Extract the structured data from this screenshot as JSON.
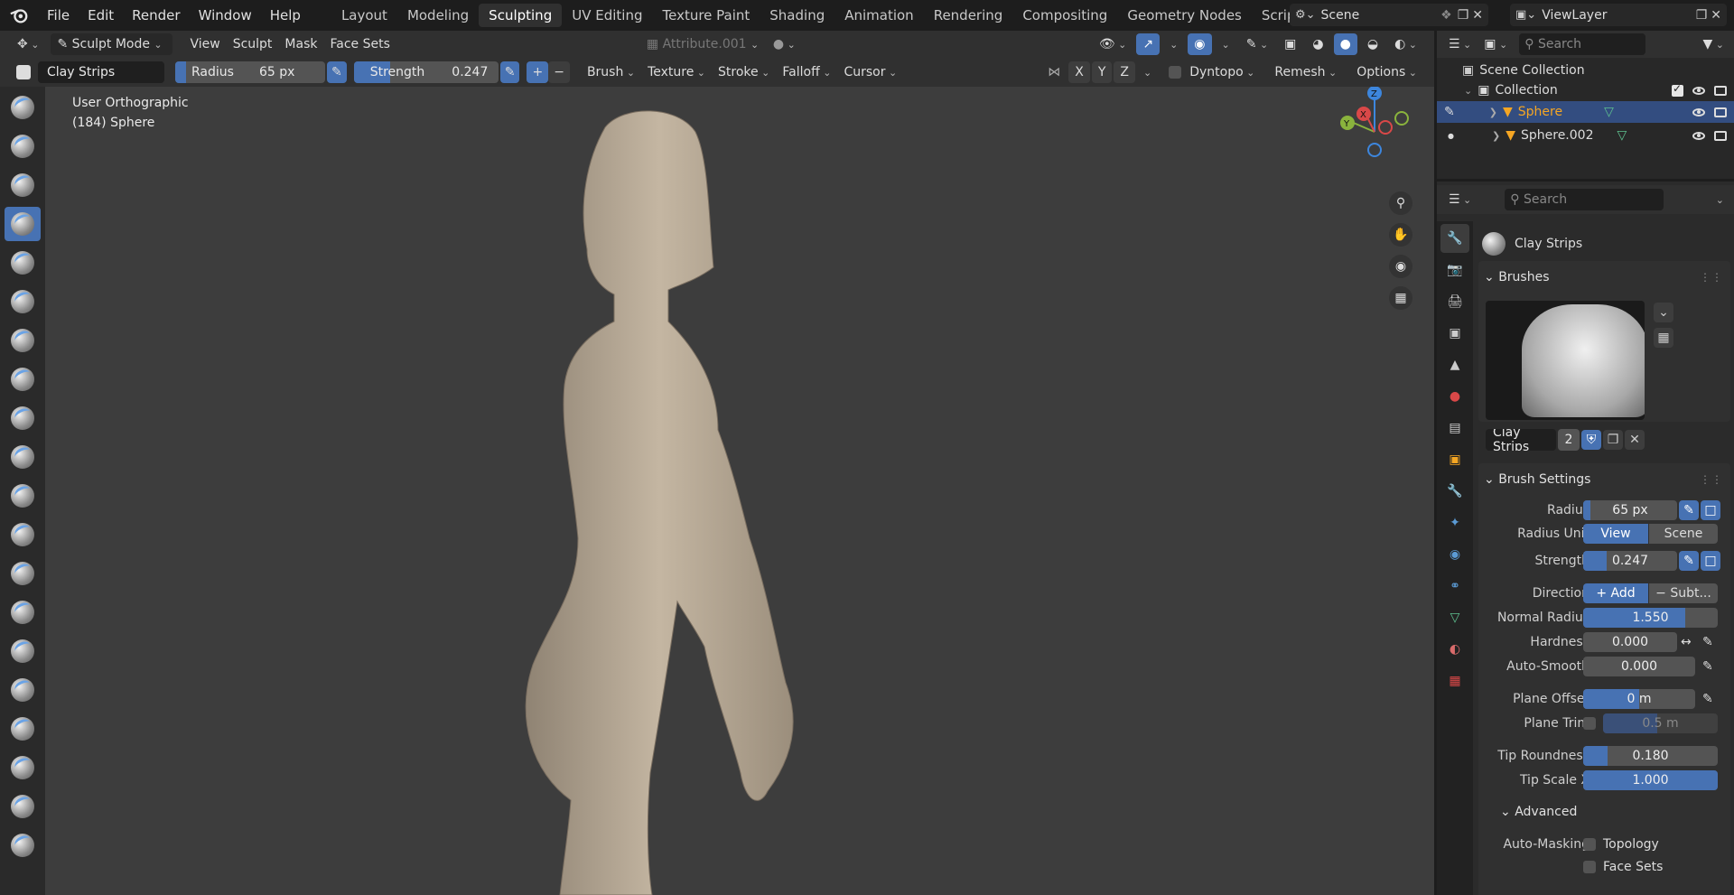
{
  "menu": [
    "File",
    "Edit",
    "Render",
    "Window",
    "Help"
  ],
  "workspaces": [
    "Layout",
    "Modeling",
    "Sculpting",
    "UV Editing",
    "Texture Paint",
    "Shading",
    "Animation",
    "Rendering",
    "Compositing",
    "Geometry Nodes",
    "Scripting"
  ],
  "active_workspace": "Sculpting",
  "scene": "Scene",
  "view_layer": "ViewLayer",
  "header": {
    "mode": "Sculpt Mode",
    "menus": [
      "View",
      "Sculpt",
      "Mask",
      "Face Sets"
    ],
    "attribute": "Attribute.001"
  },
  "tool_header": {
    "brush_name": "Clay Strips",
    "radius_label": "Radius",
    "radius_value": "65 px",
    "strength_label": "Strength",
    "strength_value": "0.247",
    "menus": [
      "Brush",
      "Texture",
      "Stroke",
      "Falloff",
      "Cursor"
    ],
    "axes": [
      "X",
      "Y",
      "Z"
    ],
    "dyntopo": "Dyntopo",
    "remesh": "Remesh",
    "options": "Options"
  },
  "viewport": {
    "view_name": "User Orthographic",
    "object_info": "(184) Sphere",
    "gizmo": {
      "z": "Z",
      "y": "Y",
      "x": "X"
    }
  },
  "outliner": {
    "search_placeholder": "Search",
    "scene_collection": "Scene Collection",
    "collection": "Collection",
    "objects": [
      "Sphere",
      "Sphere.002"
    ]
  },
  "properties": {
    "search_placeholder": "Search",
    "brush_title": "Clay Strips",
    "brushes_header": "Brushes",
    "brush_users": "2",
    "brush_settings_header": "Brush Settings",
    "radius": {
      "label": "Radius",
      "value": "65 px"
    },
    "radius_unit": {
      "label": "Radius Unit",
      "options": [
        "View",
        "Scene"
      ]
    },
    "strength": {
      "label": "Strength",
      "value": "0.247"
    },
    "direction": {
      "label": "Direction",
      "options": [
        "Add",
        "Subt..."
      ]
    },
    "normal_radius": {
      "label": "Normal Radius",
      "value": "1.550"
    },
    "hardness": {
      "label": "Hardness",
      "value": "0.000"
    },
    "auto_smooth": {
      "label": "Auto-Smooth",
      "value": "0.000"
    },
    "plane_offset": {
      "label": "Plane Offset",
      "value": "0 m"
    },
    "plane_trim": {
      "label": "Plane Trim",
      "value": "0.5 m"
    },
    "tip_roundness": {
      "label": "Tip Roundness",
      "value": "0.180"
    },
    "tip_scale_x": {
      "label": "Tip Scale X",
      "value": "1.000"
    },
    "advanced_header": "Advanced",
    "auto_masking": {
      "label": "Auto-Masking",
      "options": [
        "Topology",
        "Face Sets"
      ]
    }
  },
  "colors": {
    "accent": "#4772b3",
    "selected_text": "#f5a623",
    "mesh": "#bfb09c"
  }
}
